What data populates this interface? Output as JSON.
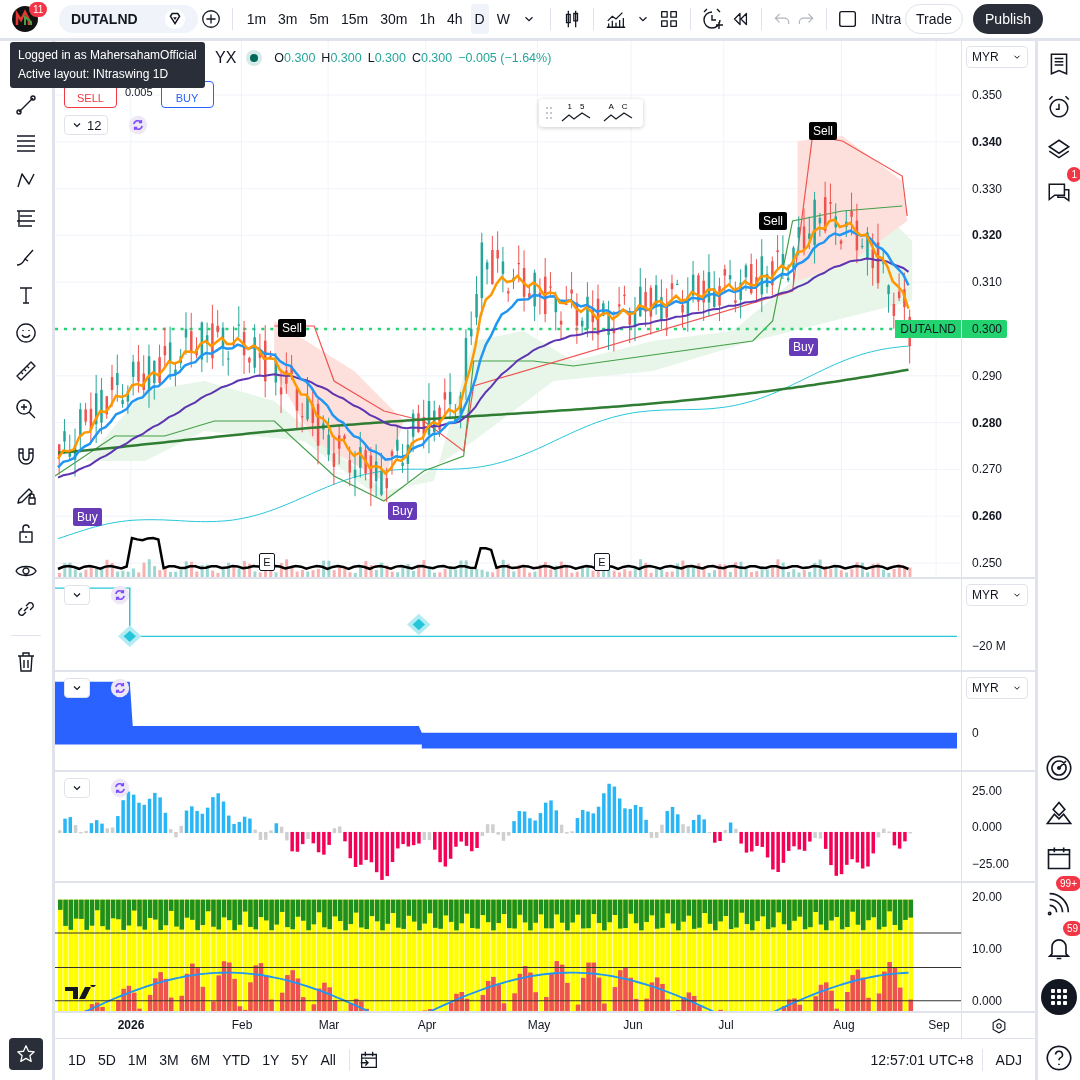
{
  "top_bar": {
    "logo_badge": "11",
    "symbol": "DUTALND",
    "intervals": [
      {
        "label": "1m",
        "selected": false
      },
      {
        "label": "3m",
        "selected": false
      },
      {
        "label": "5m",
        "selected": false
      },
      {
        "label": "15m",
        "selected": false
      },
      {
        "label": "30m",
        "selected": false
      },
      {
        "label": "1h",
        "selected": false
      },
      {
        "label": "4h",
        "selected": false
      },
      {
        "label": "D",
        "selected": true
      },
      {
        "label": "W",
        "selected": false
      }
    ],
    "undo_disabled": true,
    "redo_disabled": true,
    "layout_name": "INtra",
    "trade": "Trade",
    "publish": "Publish"
  },
  "tooltip": {
    "lines": [
      "Logged in as MahersahamOfficial",
      "Active layout: INtraswing 1D"
    ]
  },
  "legend": {
    "symbol_tail": "YX",
    "ohlc": [
      {
        "label": "O",
        "value": "0.300"
      },
      {
        "label": "H",
        "value": "0.300"
      },
      {
        "label": "L",
        "value": "0.300"
      },
      {
        "label": "C",
        "value": "0.300"
      }
    ],
    "change": "−0.005 (−1.64%)"
  },
  "trade_box": {
    "sell": "SELL",
    "spread": "0.005",
    "buy": "BUY"
  },
  "indicators_count": "12",
  "wave_tools": [
    {
      "marks": "1 5"
    },
    {
      "marks": "A C"
    }
  ],
  "signals": [
    {
      "kind": "sell",
      "label": "Sell"
    },
    {
      "kind": "sell",
      "label": "Sell"
    },
    {
      "kind": "sell",
      "label": "Sell"
    },
    {
      "kind": "buy",
      "label": "Buy"
    },
    {
      "kind": "buy",
      "label": "Buy"
    },
    {
      "kind": "buy",
      "label": "Buy"
    }
  ],
  "earnings_marks": [
    "E",
    "E"
  ],
  "price_axis": {
    "currency": "MYR",
    "ticks": [
      {
        "label": "0.350",
        "bold": false
      },
      {
        "label": "0.340",
        "bold": true
      },
      {
        "label": "0.330",
        "bold": false
      },
      {
        "label": "0.320",
        "bold": true
      },
      {
        "label": "0.310",
        "bold": false
      },
      {
        "label": "0.290",
        "bold": false
      },
      {
        "label": "0.280",
        "bold": true
      },
      {
        "label": "0.270",
        "bold": false
      },
      {
        "label": "0.260",
        "bold": true
      },
      {
        "label": "0.250",
        "bold": false
      }
    ],
    "last_price": {
      "symbol": "DUTALND",
      "price": "0.300"
    }
  },
  "panes": [
    {
      "currency": "MYR",
      "ticks": [
        "−20 M"
      ]
    },
    {
      "currency": "MYR",
      "ticks": [
        "0"
      ]
    },
    {
      "ticks": [
        "25.00",
        "0.000",
        "−25.00"
      ]
    },
    {
      "ticks": [
        "20.00",
        "10.00",
        "0.000"
      ]
    }
  ],
  "time_axis": [
    {
      "label": "2026",
      "bold": true
    },
    {
      "label": "Feb",
      "bold": false
    },
    {
      "label": "Mar",
      "bold": false
    },
    {
      "label": "Apr",
      "bold": false
    },
    {
      "label": "May",
      "bold": false
    },
    {
      "label": "Jun",
      "bold": false
    },
    {
      "label": "Jul",
      "bold": false
    },
    {
      "label": "Aug",
      "bold": false
    },
    {
      "label": "Sep",
      "bold": false
    }
  ],
  "ranges": [
    "1D",
    "5D",
    "1M",
    "3M",
    "6M",
    "YTD",
    "1Y",
    "5Y",
    "All"
  ],
  "clock": "12:57:01 UTC+8",
  "adjust": "ADJ",
  "right_sidebar": {
    "chat_badge": "1",
    "ideas_badge": "99+",
    "alerts_badge": "59"
  }
}
